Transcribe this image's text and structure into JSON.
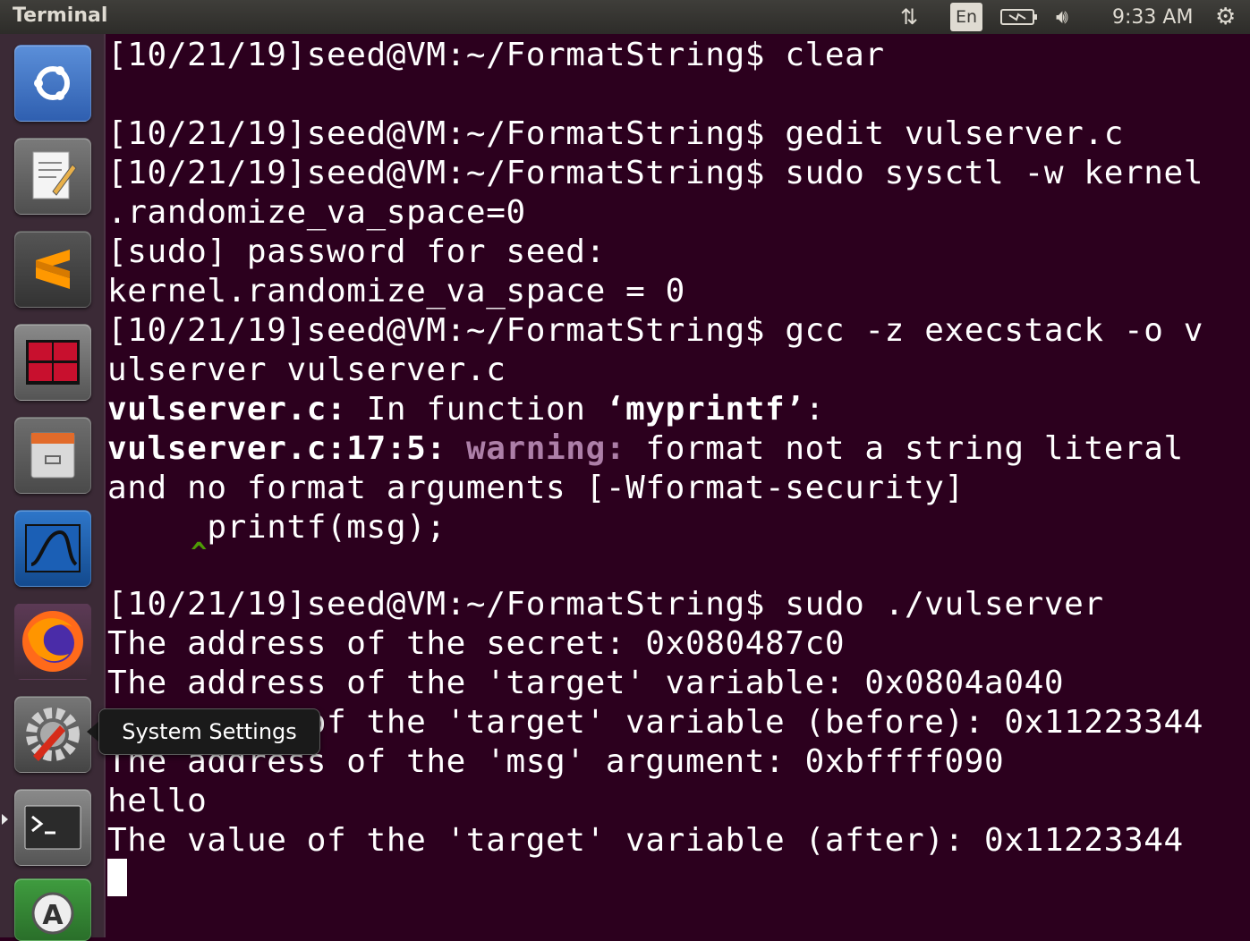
{
  "topbar": {
    "title": "Terminal",
    "network_icon": "network-arrows-icon",
    "keyboard_layout": "En",
    "battery_icon": "battery-icon",
    "volume_icon": "volume-icon",
    "clock": "9:33 AM",
    "settings_icon": "gear-icon"
  },
  "launcher": {
    "items": [
      {
        "name": "ubuntu-dash"
      },
      {
        "name": "text-editor"
      },
      {
        "name": "sublime-text"
      },
      {
        "name": "terminator"
      },
      {
        "name": "file-manager"
      },
      {
        "name": "wireshark"
      },
      {
        "name": "firefox"
      },
      {
        "name": "system-settings"
      },
      {
        "name": "terminal"
      },
      {
        "name": "software-updater"
      }
    ],
    "tooltip": "System Settings"
  },
  "terminal": {
    "prompt": "[10/21/19]seed@VM:~/FormatString$ ",
    "lines": {
      "l1": "clear",
      "l3": "gedit vulserver.c",
      "l4": "sudo sysctl -w kernel",
      "l5": ".randomize_va_space=0",
      "l6": "[sudo] password for seed:",
      "l7": "kernel.randomize_va_space = 0",
      "l8": "gcc -z execstack -o v",
      "l9": "ulserver vulserver.c",
      "l10_file": "vulserver.c:",
      "l10_text": " In function ",
      "l10_fn": "‘myprintf’",
      "l10_end": ":",
      "l11_loc": "vulserver.c:17:5:",
      "l11_warn": "warning:",
      "l11_text": " format not a string literal",
      "l12": "and no format arguments [-Wformat-security]",
      "l13": "     printf(msg);",
      "l14": "     ^",
      "l16": "sudo ./vulserver",
      "l17": "The address of the secret: 0x080487c0",
      "l18": "The address of the 'target' variable: 0x0804a040",
      "l19": "The value of the 'target' variable (before): 0x11223344",
      "l20": "The address of the 'msg' argument: 0xbffff090",
      "l21": "hello",
      "l22": "The value of the 'target' variable (after): 0x11223344"
    }
  }
}
